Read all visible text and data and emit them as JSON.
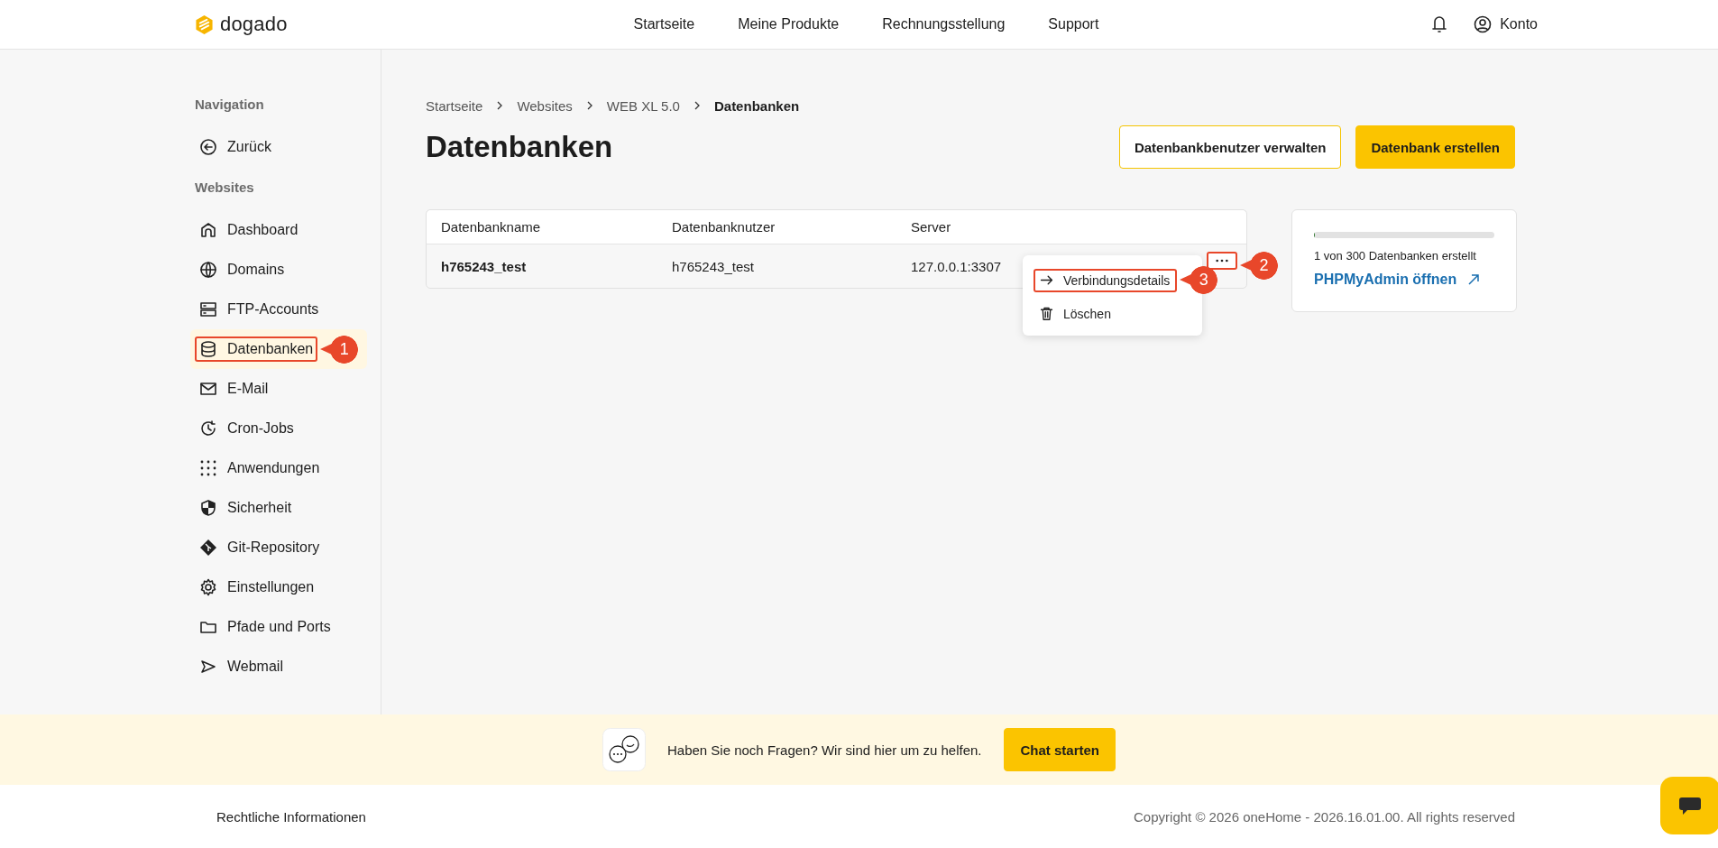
{
  "header": {
    "logo": "dogado",
    "nav": [
      {
        "label": "Startseite"
      },
      {
        "label": "Meine Produkte"
      },
      {
        "label": "Rechnungsstellung"
      },
      {
        "label": "Support"
      }
    ],
    "account": "Konto"
  },
  "sidebar": {
    "sections": [
      {
        "title": "Navigation",
        "items": [
          {
            "label": "Zurück",
            "selected": false
          }
        ]
      },
      {
        "title": "Websites",
        "items": [
          {
            "label": "Dashboard",
            "selected": false
          },
          {
            "label": "Domains",
            "selected": false
          },
          {
            "label": "FTP-Accounts",
            "selected": false
          },
          {
            "label": "Datenbanken",
            "selected": true,
            "callout": "1"
          },
          {
            "label": "E-Mail",
            "selected": false
          },
          {
            "label": "Cron-Jobs",
            "selected": false
          },
          {
            "label": "Anwendungen",
            "selected": false
          },
          {
            "label": "Sicherheit",
            "selected": false
          },
          {
            "label": "Git-Repository",
            "selected": false
          },
          {
            "label": "Einstellungen",
            "selected": false
          },
          {
            "label": "Pfade und Ports",
            "selected": false
          },
          {
            "label": "Webmail",
            "selected": false
          }
        ]
      }
    ]
  },
  "breadcrumb": [
    {
      "label": "Startseite",
      "current": false
    },
    {
      "label": "Websites",
      "current": false
    },
    {
      "label": "WEB XL 5.0",
      "current": false
    },
    {
      "label": "Datenbanken",
      "current": true
    }
  ],
  "title": "Datenbanken",
  "actions": [
    {
      "label": "Datenbankbenutzer verwalten",
      "kind": "outline"
    },
    {
      "label": "Datenbank erstellen",
      "kind": "primary"
    }
  ],
  "table": {
    "columns": [
      "Datenbankname",
      "Datenbanknutzer",
      "Server"
    ],
    "rows": [
      {
        "cells": [
          "h765243_test",
          "h765243_test",
          "127.0.0.1:3307"
        ],
        "callout": "2"
      }
    ]
  },
  "row_menu": {
    "items": [
      {
        "label": "Verbindungsdetails",
        "callout": "3"
      },
      {
        "label": "Löschen"
      }
    ]
  },
  "usage_card": {
    "level": 0.004,
    "text": "1 von 300 Datenbanken erstellt",
    "link": "PHPMyAdmin öffnen"
  },
  "help_band": {
    "text": "Haben Sie noch Fragen? Wir sind hier um zu helfen.",
    "button": "Chat starten"
  },
  "footer": {
    "legal": "Rechtliche Informationen",
    "copyright": "Copyright © 2026 oneHome - 2026.16.01.00. All rights reserved"
  }
}
